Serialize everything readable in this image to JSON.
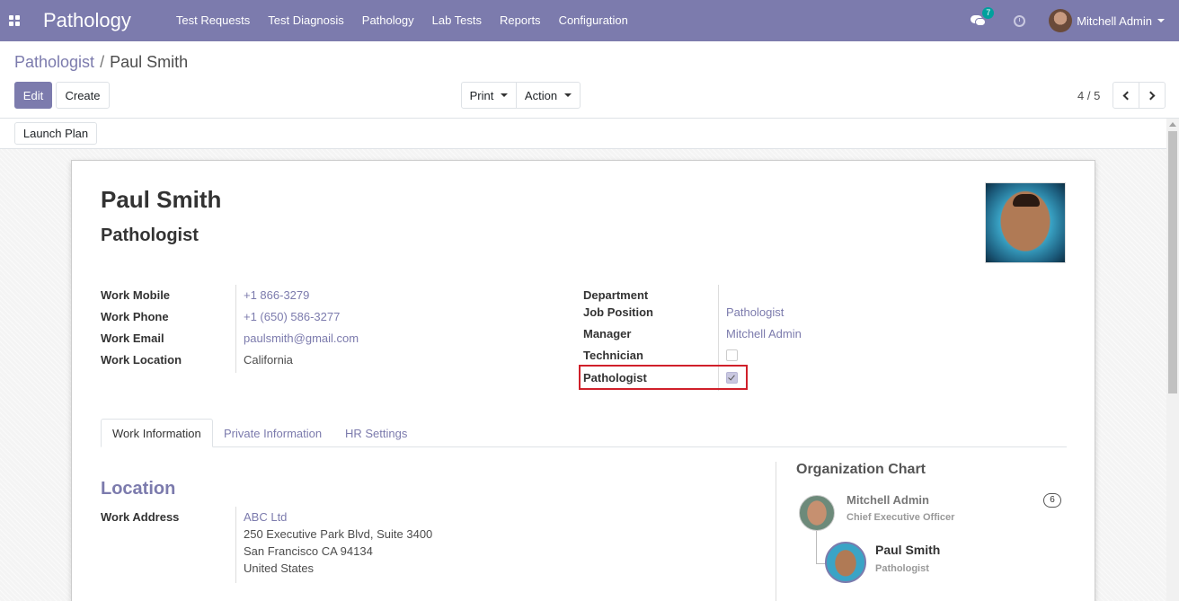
{
  "navbar": {
    "brand": "Pathology",
    "menu": [
      "Test Requests",
      "Test Diagnosis",
      "Pathology",
      "Lab Tests",
      "Reports",
      "Configuration"
    ],
    "chat_count": "7",
    "user_name": "Mitchell Admin"
  },
  "breadcrumb": {
    "parent": "Pathologist",
    "separator": "/",
    "current": "Paul Smith"
  },
  "toolbar": {
    "edit_label": "Edit",
    "create_label": "Create",
    "print_label": "Print",
    "action_label": "Action",
    "pager": "4 / 5",
    "launch_plan_label": "Launch Plan"
  },
  "employee": {
    "name": "Paul Smith",
    "job_title": "Pathologist",
    "left_fields": [
      {
        "label": "Work Mobile",
        "value": "+1 866-3279"
      },
      {
        "label": "Work Phone",
        "value": "+1 (650) 586-3277"
      },
      {
        "label": "Work Email",
        "value": "paulsmith@gmail.com"
      },
      {
        "label": "Work Location",
        "value": "California"
      }
    ],
    "right_fields": [
      {
        "label": "Department",
        "value": ""
      },
      {
        "label": "Job Position",
        "value": "Pathologist"
      },
      {
        "label": "Manager",
        "value": "Mitchell Admin"
      },
      {
        "label": "Technician",
        "checked": false
      },
      {
        "label": "Pathologist",
        "checked": true
      }
    ]
  },
  "tabs": [
    "Work Information",
    "Private Information",
    "HR Settings"
  ],
  "location": {
    "title": "Location",
    "work_address_label": "Work Address",
    "company": "ABC Ltd",
    "address_lines": [
      "250 Executive Park Blvd, Suite 3400",
      "San Francisco CA 94134",
      "United States"
    ]
  },
  "org_chart": {
    "title": "Organization Chart",
    "manager": {
      "name": "Mitchell Admin",
      "job": "Chief Executive Officer",
      "count": "6"
    },
    "self": {
      "name": "Paul Smith",
      "job": "Pathologist"
    }
  },
  "colors": {
    "brand": "#7c7bad",
    "highlight": "#d0202a"
  },
  "icons": [
    "apps-icon",
    "chat-icon",
    "clock-icon",
    "chevron-left-icon",
    "chevron-right-icon",
    "caret-down-icon"
  ]
}
